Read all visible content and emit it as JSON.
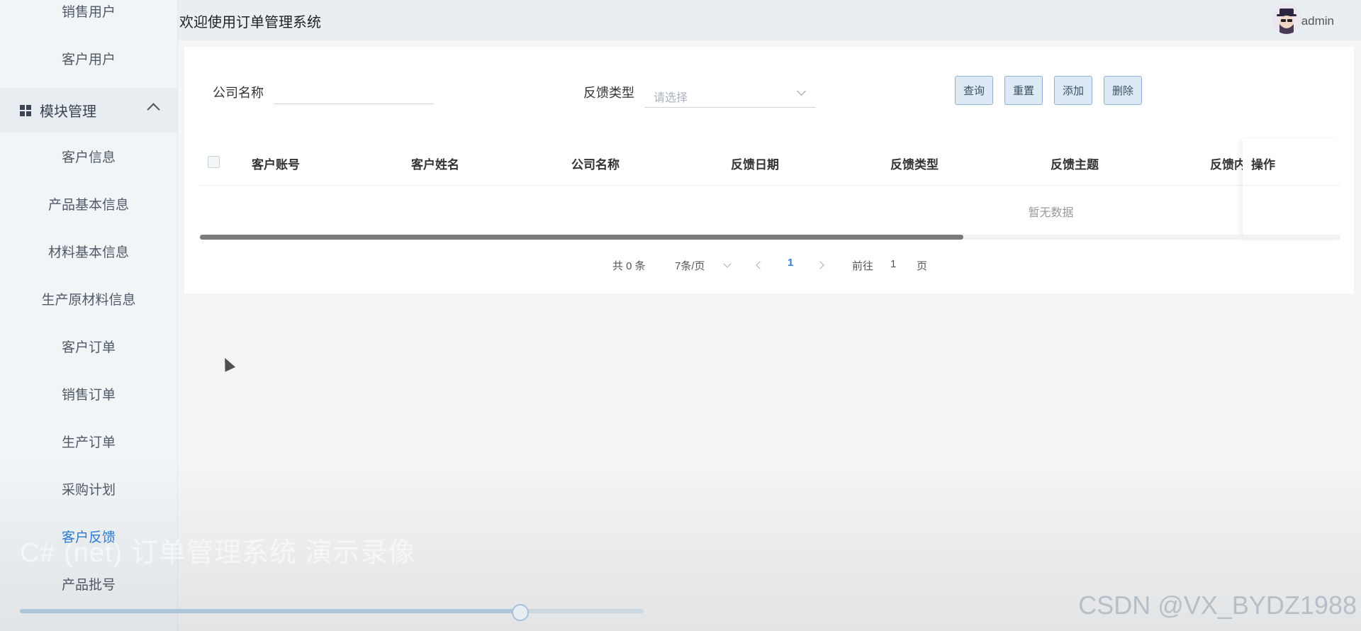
{
  "sidebar": {
    "items_top": [
      {
        "label": "销售用户"
      },
      {
        "label": "客户用户"
      }
    ],
    "group": {
      "label": "模块管理",
      "icon": "grid-icon"
    },
    "items_sub": [
      {
        "label": "客户信息"
      },
      {
        "label": "产品基本信息"
      },
      {
        "label": "材料基本信息"
      },
      {
        "label": "生产原材料信息"
      },
      {
        "label": "客户订单"
      },
      {
        "label": "销售订单"
      },
      {
        "label": "生产订单"
      },
      {
        "label": "采购计划"
      },
      {
        "label": "客户反馈",
        "active": true
      },
      {
        "label": "产品批号"
      }
    ]
  },
  "header": {
    "title": "欢迎使用订单管理系统",
    "username": "admin"
  },
  "search": {
    "company_label": "公司名称",
    "company_value": "",
    "feedback_type_label": "反馈类型",
    "feedback_type_placeholder": "请选择"
  },
  "buttons": {
    "query": "查询",
    "reset": "重置",
    "add": "添加",
    "delete": "删除"
  },
  "table": {
    "columns": [
      "客户账号",
      "客户姓名",
      "公司名称",
      "反馈日期",
      "反馈类型",
      "反馈主题",
      "反馈内"
    ],
    "fixed_column": "操作",
    "empty_text": "暂无数据",
    "horizontal_scroll_fraction": 0.67
  },
  "pagination": {
    "total_text": "共 0 条",
    "page_size_text": "7条/页",
    "current_page": "1",
    "goto_prefix": "前往",
    "goto_value": "1",
    "goto_suffix": "页"
  },
  "overlay": {
    "video_caption": "C# (net) 订单管理系统 演示录像",
    "watermark": "CSDN @VX_BYDZ1988",
    "video_progress_fraction": 0.8
  },
  "colors": {
    "accent": "#2f7fd8",
    "sidebar_bg": "#f1f5f8",
    "header_bg": "#e9eef3",
    "button_bg": "#dde9f4"
  }
}
